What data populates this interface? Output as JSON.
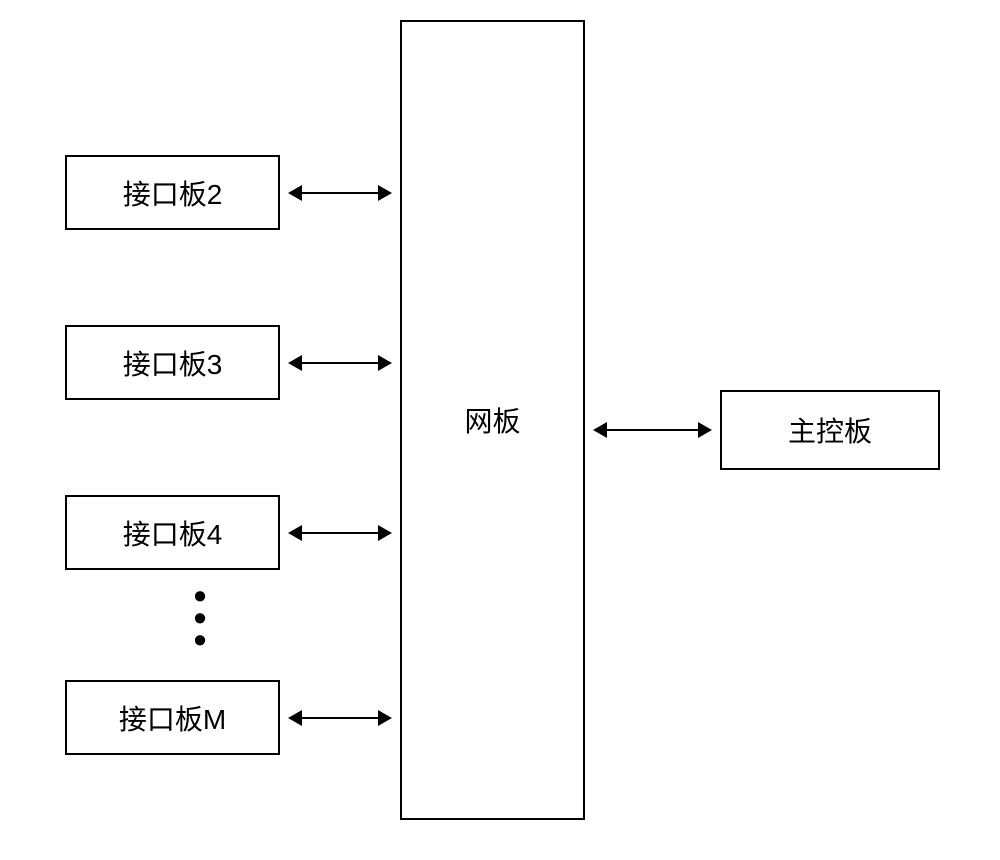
{
  "interface_boards": {
    "b2": "接口板2",
    "b3": "接口板3",
    "b4": "接口板4",
    "bM": "接口板M"
  },
  "center_board": "网板",
  "main_board": "主控板",
  "ellipsis": "•"
}
